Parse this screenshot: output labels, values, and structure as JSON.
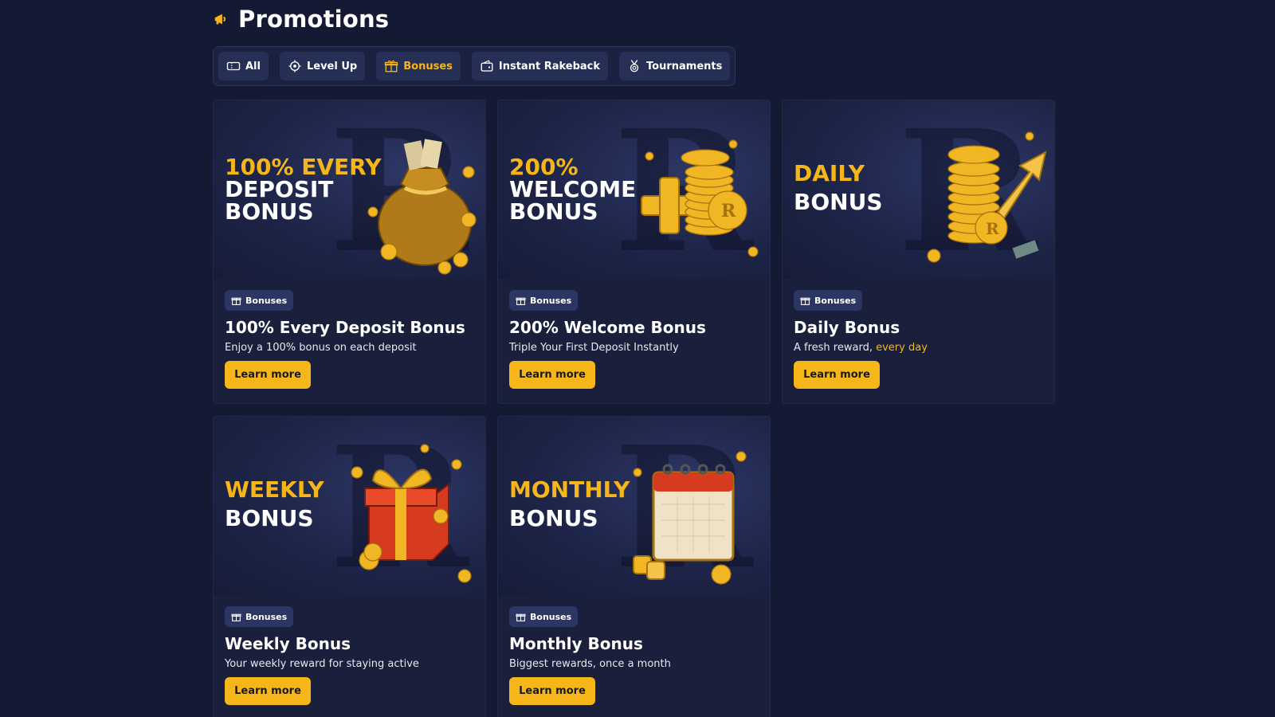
{
  "header": {
    "title": "Promotions",
    "icon": "megaphone-icon"
  },
  "tabs": [
    {
      "label": "All",
      "icon": "ticket-icon",
      "active": false
    },
    {
      "label": "Level Up",
      "icon": "gear-badge-icon",
      "active": false
    },
    {
      "label": "Bonuses",
      "icon": "gift-icon",
      "active": true
    },
    {
      "label": "Instant Rakeback",
      "icon": "wallet-icon",
      "active": false
    },
    {
      "label": "Tournaments",
      "icon": "medal-icon",
      "active": false
    }
  ],
  "colors": {
    "accent": "#f6b619",
    "background": "#141a33",
    "card": "#1a203c",
    "badge": "#2c3662"
  },
  "cards": [
    {
      "banner_line1": "100% EVERY",
      "banner_line2": "DEPOSIT",
      "banner_line3": "BONUS",
      "badge": "Bonuses",
      "title": "100% Every Deposit Bonus",
      "desc": "Enjoy a 100% bonus on each deposit",
      "button": "Learn more"
    },
    {
      "banner_line1": "200%",
      "banner_line2": "WELCOME",
      "banner_line3": "BONUS",
      "badge": "Bonuses",
      "title": "200% Welcome Bonus",
      "desc": "Triple Your First Deposit Instantly",
      "button": "Learn more"
    },
    {
      "banner_line1": "DAILY",
      "banner_line2": "BONUS",
      "badge": "Bonuses",
      "title": "Daily Bonus",
      "desc": "A fresh reward,",
      "desc_highlight": "every day",
      "button": "Learn more"
    },
    {
      "banner_line1": "WEEKLY",
      "banner_line2": "BONUS",
      "badge": "Bonuses",
      "title": "Weekly Bonus",
      "desc": "Your weekly reward for staying active",
      "button": "Learn more"
    },
    {
      "banner_line1": "MONTHLY",
      "banner_line2": "BONUS",
      "badge": "Bonuses",
      "title": "Monthly Bonus",
      "desc": "Biggest rewards, once a month",
      "button": "Learn more"
    }
  ]
}
